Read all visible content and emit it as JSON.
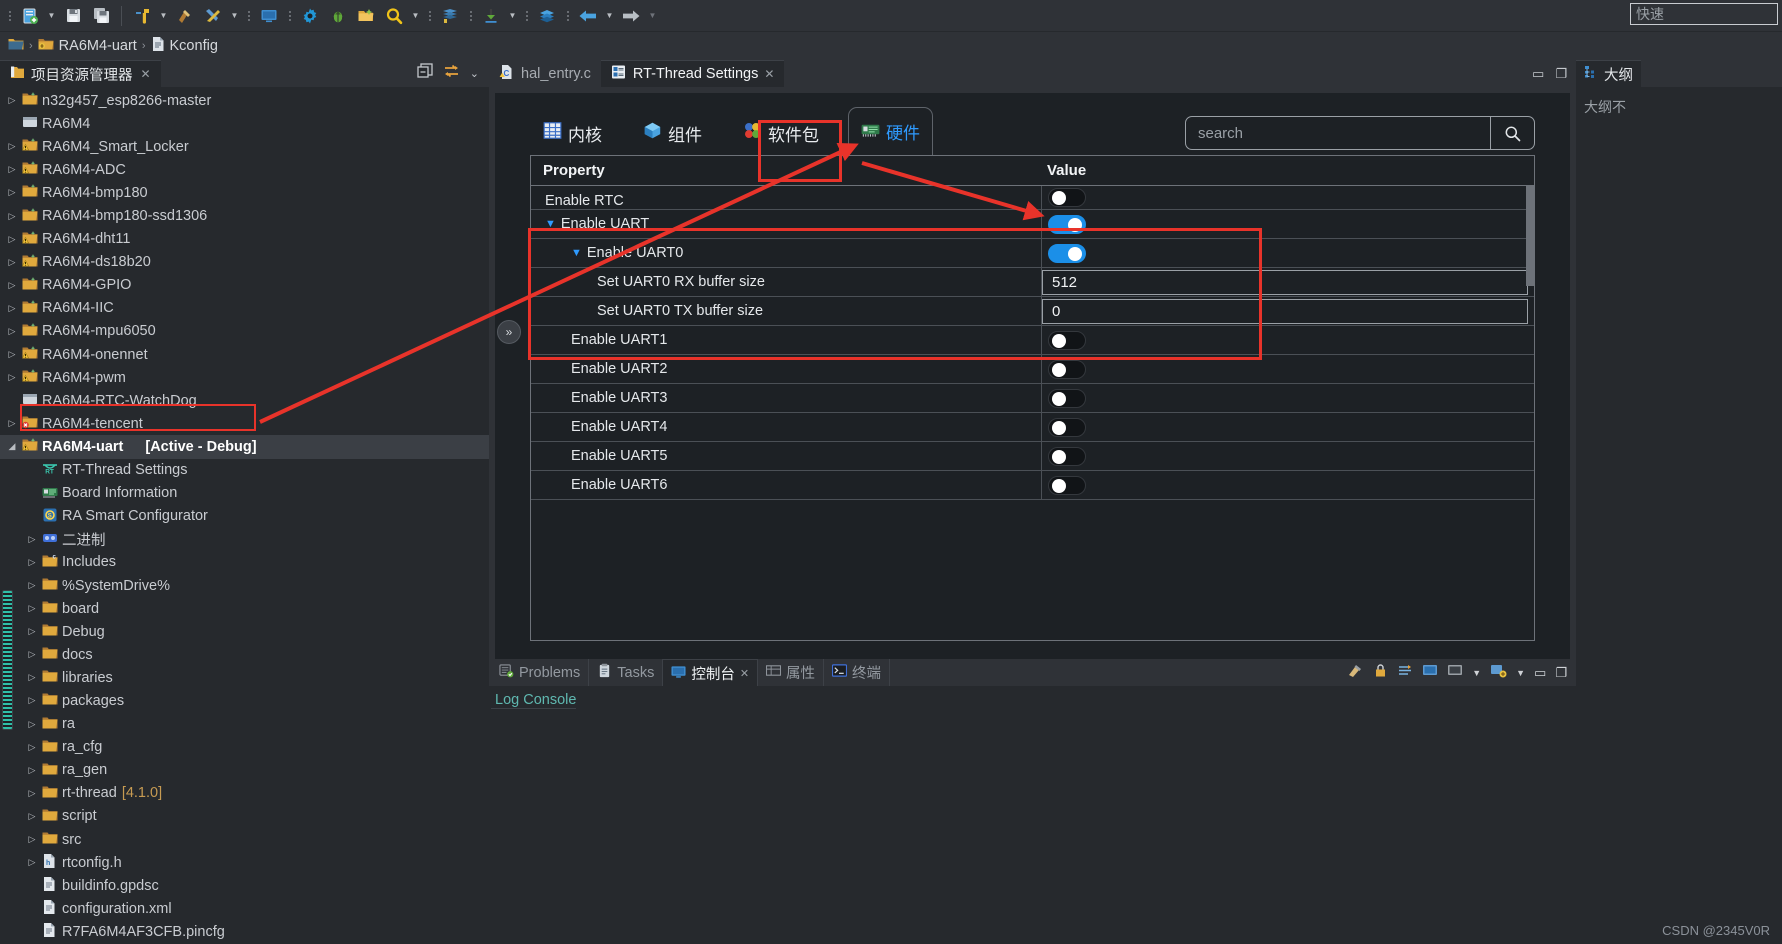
{
  "window": {
    "quick_access_placeholder": "快速"
  },
  "toolbar": {
    "items": [
      {
        "name": "new-project-icon",
        "glyph": "🗒"
      },
      {
        "name": "new-dropdown-arrow",
        "glyph": "▾"
      },
      {
        "name": "save-icon",
        "glyph": "💾"
      },
      {
        "name": "save-all-icon",
        "glyph": "🖫"
      },
      {
        "name": "build-icon",
        "glyph": "🔨"
      },
      {
        "name": "build-dropdown-arrow",
        "glyph": "▾"
      },
      {
        "name": "clean-icon",
        "glyph": "🪝"
      },
      {
        "name": "tools-icon",
        "glyph": "🛠"
      },
      {
        "name": "tools-dropdown-arrow",
        "glyph": "▾"
      },
      {
        "name": "console-icon",
        "glyph": "🖥"
      },
      {
        "name": "settings-gear-icon",
        "glyph": "⚙"
      },
      {
        "name": "debug-bug-icon",
        "glyph": "🐞"
      },
      {
        "name": "run-folder-icon",
        "glyph": "📂"
      },
      {
        "name": "search-icon",
        "glyph": "🔍"
      },
      {
        "name": "search-dropdown-arrow",
        "glyph": "▾"
      },
      {
        "name": "library-icon",
        "glyph": "📚"
      },
      {
        "name": "download-icon",
        "glyph": "⬇"
      },
      {
        "name": "download-dropdown-arrow",
        "glyph": "▾"
      },
      {
        "name": "layers-icon",
        "glyph": "◆"
      },
      {
        "name": "back-arrow-icon",
        "glyph": "⬅"
      },
      {
        "name": "back-dropdown-arrow",
        "glyph": "▾"
      },
      {
        "name": "forward-arrow-icon",
        "glyph": "➡"
      },
      {
        "name": "forward-dropdown-arrow",
        "glyph": "▾"
      }
    ]
  },
  "breadcrumb": {
    "root_icon": "folder-icon",
    "project": "RA6M4-uart",
    "file": "Kconfig",
    "separator": "›"
  },
  "project_explorer": {
    "tab_label": "项目资源管理器",
    "tools": [
      "link-with-editor-icon",
      "collapse-all-icon",
      "view-menu-icon"
    ],
    "tree": [
      {
        "label": "n32g457_esp8266-master",
        "icon": "project-icon",
        "arrow": "▷",
        "indent": 0
      },
      {
        "label": "RA6M4",
        "icon": "closed-project-icon",
        "arrow": "",
        "indent": 0
      },
      {
        "label": "RA6M4_Smart_Locker",
        "icon": "project-warning-icon",
        "arrow": "▷",
        "indent": 0
      },
      {
        "label": "RA6M4-ADC",
        "icon": "project-warning-icon",
        "arrow": "▷",
        "indent": 0
      },
      {
        "label": "RA6M4-bmp180",
        "icon": "project-icon",
        "arrow": "▷",
        "indent": 0
      },
      {
        "label": "RA6M4-bmp180-ssd1306",
        "icon": "project-icon",
        "arrow": "▷",
        "indent": 0
      },
      {
        "label": "RA6M4-dht11",
        "icon": "project-warning-icon",
        "arrow": "▷",
        "indent": 0
      },
      {
        "label": "RA6M4-ds18b20",
        "icon": "project-warning-icon",
        "arrow": "▷",
        "indent": 0
      },
      {
        "label": "RA6M4-GPIO",
        "icon": "project-icon",
        "arrow": "▷",
        "indent": 0
      },
      {
        "label": "RA6M4-IIC",
        "icon": "project-icon",
        "arrow": "▷",
        "indent": 0
      },
      {
        "label": "RA6M4-mpu6050",
        "icon": "project-icon",
        "arrow": "▷",
        "indent": 0
      },
      {
        "label": "RA6M4-onennet",
        "icon": "project-warning-icon",
        "arrow": "▷",
        "indent": 0
      },
      {
        "label": "RA6M4-pwm",
        "icon": "project-warning-icon",
        "arrow": "▷",
        "indent": 0
      },
      {
        "label": "RA6M4-RTC-WatchDog",
        "icon": "closed-project-icon",
        "arrow": "",
        "indent": 0
      },
      {
        "label": "RA6M4-tencent",
        "icon": "project-error-icon",
        "arrow": "▷",
        "indent": 0
      },
      {
        "label": "RA6M4-uart",
        "suffix": "[Active - Debug]",
        "icon": "project-warning-icon",
        "arrow": "◢",
        "indent": 0,
        "selected": true
      },
      {
        "label": "RT-Thread Settings",
        "icon": "rt-thread-icon",
        "arrow": "",
        "indent": 1,
        "highlighted": true
      },
      {
        "label": "Board Information",
        "icon": "board-icon",
        "arrow": "",
        "indent": 1
      },
      {
        "label": "RA Smart Configurator",
        "icon": "ra-config-icon",
        "arrow": "",
        "indent": 1
      },
      {
        "label": "二进制",
        "icon": "binaries-icon",
        "arrow": "▷",
        "indent": 1
      },
      {
        "label": "Includes",
        "icon": "includes-icon",
        "arrow": "▷",
        "indent": 1
      },
      {
        "label": "%SystemDrive%",
        "icon": "folder-icon",
        "arrow": "▷",
        "indent": 1
      },
      {
        "label": "board",
        "icon": "folder-icon",
        "arrow": "▷",
        "indent": 1
      },
      {
        "label": "Debug",
        "icon": "folder-icon",
        "arrow": "▷",
        "indent": 1
      },
      {
        "label": "docs",
        "icon": "folder-icon",
        "arrow": "▷",
        "indent": 1
      },
      {
        "label": "libraries",
        "icon": "folder-icon",
        "arrow": "▷",
        "indent": 1
      },
      {
        "label": "packages",
        "icon": "folder-icon",
        "arrow": "▷",
        "indent": 1
      },
      {
        "label": "ra",
        "icon": "folder-icon",
        "arrow": "▷",
        "indent": 1
      },
      {
        "label": "ra_cfg",
        "icon": "folder-icon",
        "arrow": "▷",
        "indent": 1
      },
      {
        "label": "ra_gen",
        "icon": "folder-icon",
        "arrow": "▷",
        "indent": 1
      },
      {
        "label": "rt-thread",
        "suffix_version": "[4.1.0]",
        "icon": "folder-icon",
        "arrow": "▷",
        "indent": 1
      },
      {
        "label": "script",
        "icon": "folder-icon",
        "arrow": "▷",
        "indent": 1
      },
      {
        "label": "src",
        "icon": "folder-icon",
        "arrow": "▷",
        "indent": 1
      },
      {
        "label": "rtconfig.h",
        "icon": "c-header-icon",
        "arrow": "▷",
        "indent": 1
      },
      {
        "label": "buildinfo.gpdsc",
        "icon": "file-icon",
        "arrow": "",
        "indent": 1
      },
      {
        "label": "configuration.xml",
        "icon": "file-icon",
        "arrow": "",
        "indent": 1
      },
      {
        "label": "R7FA6M4AF3CFB.pincfg",
        "icon": "file-icon",
        "arrow": "",
        "indent": 1
      }
    ]
  },
  "editor": {
    "tabs": [
      {
        "label": "hal_entry.c",
        "icon": "c-file-warning-icon",
        "active": false,
        "closable": false
      },
      {
        "label": "RT-Thread Settings",
        "icon": "rt-settings-icon",
        "active": true,
        "closable": true
      }
    ],
    "tools": [
      "minimize-icon",
      "maximize-icon"
    ]
  },
  "rt_settings": {
    "tabs": [
      {
        "label": "内核",
        "icon": "kernel-icon",
        "active": false
      },
      {
        "label": "组件",
        "icon": "components-icon",
        "active": false
      },
      {
        "label": "软件包",
        "icon": "packages-icon",
        "active": false
      },
      {
        "label": "硬件",
        "icon": "hardware-icon",
        "active": true
      }
    ],
    "search": {
      "placeholder": "search",
      "value": "",
      "button_icon": "search-icon"
    },
    "table": {
      "headers": {
        "property": "Property",
        "value": "Value"
      },
      "rows": [
        {
          "label": "Enable RTC",
          "indent": 0,
          "type": "toggle",
          "value": "off",
          "clipped_top": true
        },
        {
          "label": "Enable UART",
          "indent": 0,
          "type": "toggle",
          "value": "on",
          "caret": "▼"
        },
        {
          "label": "Enable UART0",
          "indent": 1,
          "type": "toggle",
          "value": "on",
          "caret": "▼"
        },
        {
          "label": "Set UART0 RX buffer size",
          "indent": 2,
          "type": "input",
          "value": "512"
        },
        {
          "label": "Set UART0 TX buffer size",
          "indent": 2,
          "type": "input",
          "value": "0"
        },
        {
          "label": "Enable UART1",
          "indent": 1,
          "type": "toggle",
          "value": "off"
        },
        {
          "label": "Enable UART2",
          "indent": 1,
          "type": "toggle",
          "value": "off"
        },
        {
          "label": "Enable UART3",
          "indent": 1,
          "type": "toggle",
          "value": "off"
        },
        {
          "label": "Enable UART4",
          "indent": 1,
          "type": "toggle",
          "value": "off"
        },
        {
          "label": "Enable UART5",
          "indent": 1,
          "type": "toggle",
          "value": "off"
        },
        {
          "label": "Enable UART6",
          "indent": 1,
          "type": "toggle",
          "value": "off"
        }
      ]
    }
  },
  "console": {
    "tabs": [
      {
        "label": "Problems",
        "icon": "problems-icon",
        "active": false,
        "closable": false
      },
      {
        "label": "Tasks",
        "icon": "tasks-icon",
        "active": false,
        "closable": false
      },
      {
        "label": "控制台",
        "icon": "console-icon",
        "active": true,
        "closable": true
      },
      {
        "label": "属性",
        "icon": "properties-icon",
        "active": false,
        "closable": false
      },
      {
        "label": "终端",
        "icon": "terminal-icon",
        "active": false,
        "closable": false
      }
    ],
    "tools": [
      "clear-icon",
      "lock-icon",
      "scroll-lock-icon",
      "display-selected-icon",
      "pin-console-icon",
      "open-console-dropdown-icon",
      "new-console-icon",
      "minimize-icon",
      "maximize-icon"
    ],
    "log_title": "Log Console",
    "log_body": ""
  },
  "outline": {
    "tab_label": "大纲",
    "tab_icon": "outline-icon",
    "empty_message": "大纲不"
  },
  "annotations": {
    "color": "#e8332a",
    "boxes": [
      "rt-thread-settings-tree-item",
      "hardware-tab",
      "uart-settings-rows"
    ],
    "arrows": [
      "tree-to-hardware-tab",
      "hardware-tab-to-enable-rtc-toggle"
    ]
  },
  "watermark": {
    "text": "CSDN @2345V0R"
  }
}
